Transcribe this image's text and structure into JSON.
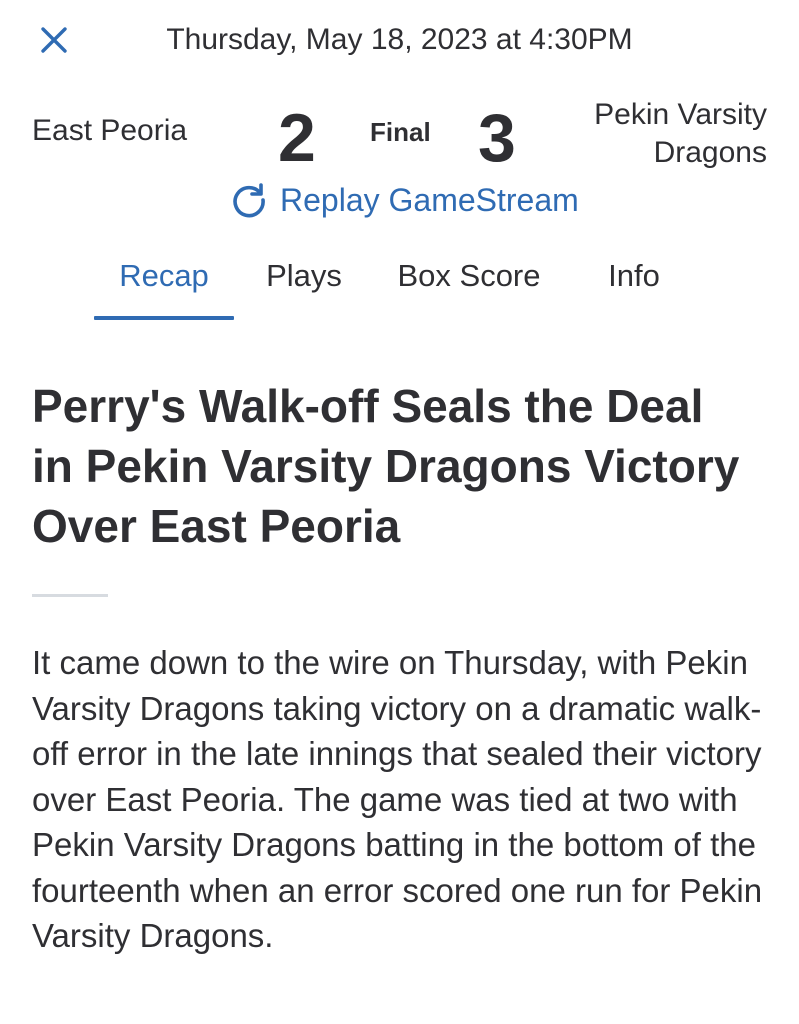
{
  "header": {
    "close_icon": "close-icon",
    "datetime": "Thursday, May 18, 2023 at 4:30PM"
  },
  "game": {
    "away_team": "East Peoria",
    "away_score": "2",
    "status": "Final",
    "home_score": "3",
    "home_team_line1": "Pekin Varsity",
    "home_team_line2": "Dragons"
  },
  "replay": {
    "icon": "refresh-icon",
    "label": "Replay GameStream"
  },
  "tabs": [
    {
      "label": "Recap",
      "active": true
    },
    {
      "label": "Plays",
      "active": false
    },
    {
      "label": "Box Score",
      "active": false
    },
    {
      "label": "Info",
      "active": false
    }
  ],
  "article": {
    "headline": "Perry's Walk-off Seals the Deal in Pekin Varsity Dragons Victory Over East Peoria",
    "body": "It came down to the wire on Thursday, with Pekin Varsity Dragons taking victory on a dramatic walk-off error in the late innings that sealed their victory over East Peoria. The game was tied at two with Pekin Varsity Dragons batting in the bottom of the fourteenth when an error scored one run for Pekin Varsity Dragons."
  },
  "colors": {
    "accent": "#2f6bb3",
    "text": "#2f2f33",
    "divider": "#d7dbe0",
    "background": "#ffffff"
  }
}
